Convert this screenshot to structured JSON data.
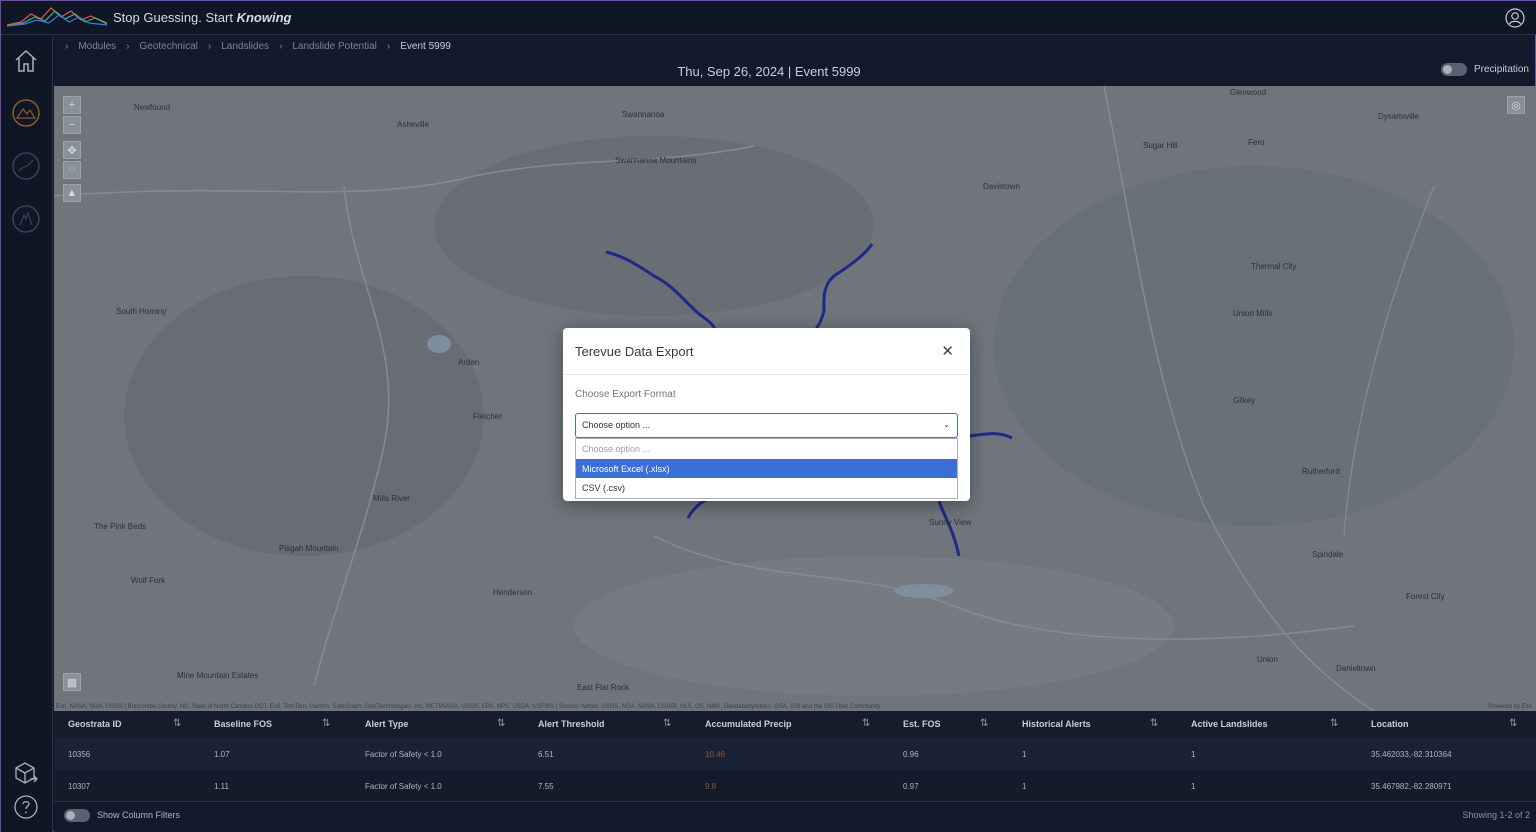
{
  "header": {
    "tagline_prefix": "Stop Guessing. Start ",
    "tagline_emphasis": "Knowing"
  },
  "breadcrumb": [
    "Modules",
    "Geotechnical",
    "Landslides",
    "Landslide Potential",
    "Event 5999"
  ],
  "event_title": "Thu, Sep 26, 2024 | Event 5999",
  "precipitation_label": "Precipitation",
  "map": {
    "places": [
      "Asheville",
      "Newfound",
      "Swannanoa",
      "Swannanoa Mountains",
      "Glenwood",
      "Dysartsville",
      "Sugar Hill",
      "Fero",
      "Davistown",
      "Thermal City",
      "Union Mills",
      "Gilkey",
      "Rutherford",
      "Spindale",
      "Forest City",
      "Union",
      "Danieltown",
      "Arden",
      "Fletcher",
      "Mills River",
      "The Pink Beds",
      "Pisgah Mountain",
      "Wolf Fork",
      "Mine Mountain Estates",
      "Henderson",
      "East Flat Rock",
      "South Hominy",
      "Sunny View"
    ],
    "attribution": "Esri, NASA, NGA, USGS | Buncombe County, NC, State of North Carolina DOT, Esri, TomTom, Garmin, SafeGraph, GeoTechnologies, Inc, METI/NASA, USGS, EPA, NPS, USDA, USFWS | Source: Airbus, USGS, NGA, NASA, CGIAR, NLS, OS, NMA, Geodatastyrelsen, GSA, GSI and the GIS User Community",
    "powered_by": "Powered by Esri"
  },
  "modal": {
    "title": "Terevue Data Export",
    "label": "Choose Export Format",
    "select_value": "Choose option ...",
    "options": [
      "Choose option ...",
      "Microsoft Excel (.xlsx)",
      "CSV (.csv)"
    ],
    "selected_index": 1
  },
  "table": {
    "columns": [
      "Geostrata ID",
      "Baseline FOS",
      "Alert Type",
      "Alert Threshold",
      "Accumulated Precip",
      "Est. FOS",
      "Historical Alerts",
      "Active Landslides",
      "Location"
    ],
    "rows": [
      [
        "10356",
        "1.07",
        "Factor of Safety < 1.0",
        "6.51",
        "10.46",
        "0.96",
        "1",
        "1",
        "35.462033,-82.310364"
      ],
      [
        "10307",
        "1.11",
        "Factor of Safety < 1.0",
        "7.55",
        "9.8",
        "0.97",
        "1",
        "1",
        "35.467982,-82.280971"
      ]
    ]
  },
  "footer": {
    "filter_label": "Show Column Filters",
    "showing": "Showing 1-2 of 2"
  },
  "colors": {
    "accent": "#3b6fd6",
    "precip_value": "#8a5a32",
    "stream": "#1e2a8a"
  }
}
